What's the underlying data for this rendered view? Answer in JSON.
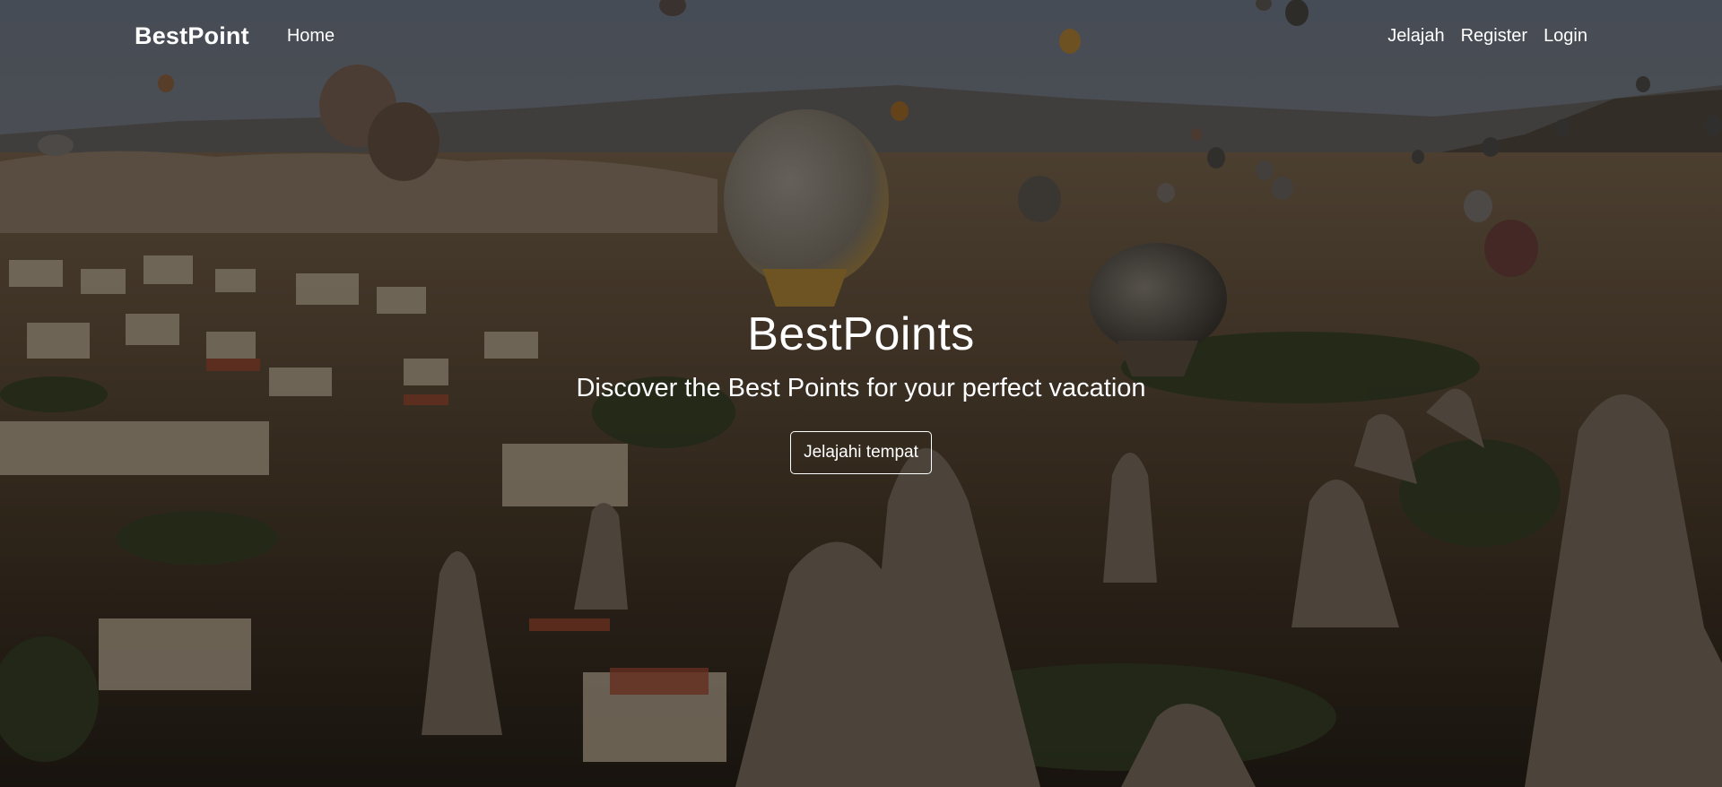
{
  "navbar": {
    "brand": "BestPoint",
    "home_label": "Home",
    "links": [
      {
        "label": "Jelajah"
      },
      {
        "label": "Register"
      },
      {
        "label": "Login"
      }
    ]
  },
  "hero": {
    "title": "BestPoints",
    "subtitle": "Discover the Best Points for your perfect vacation",
    "cta_label": "Jelajahi tempat",
    "background": "hot-air-balloons-valley-photo"
  },
  "colors": {
    "overlay": "#000000",
    "text": "#ffffff"
  }
}
